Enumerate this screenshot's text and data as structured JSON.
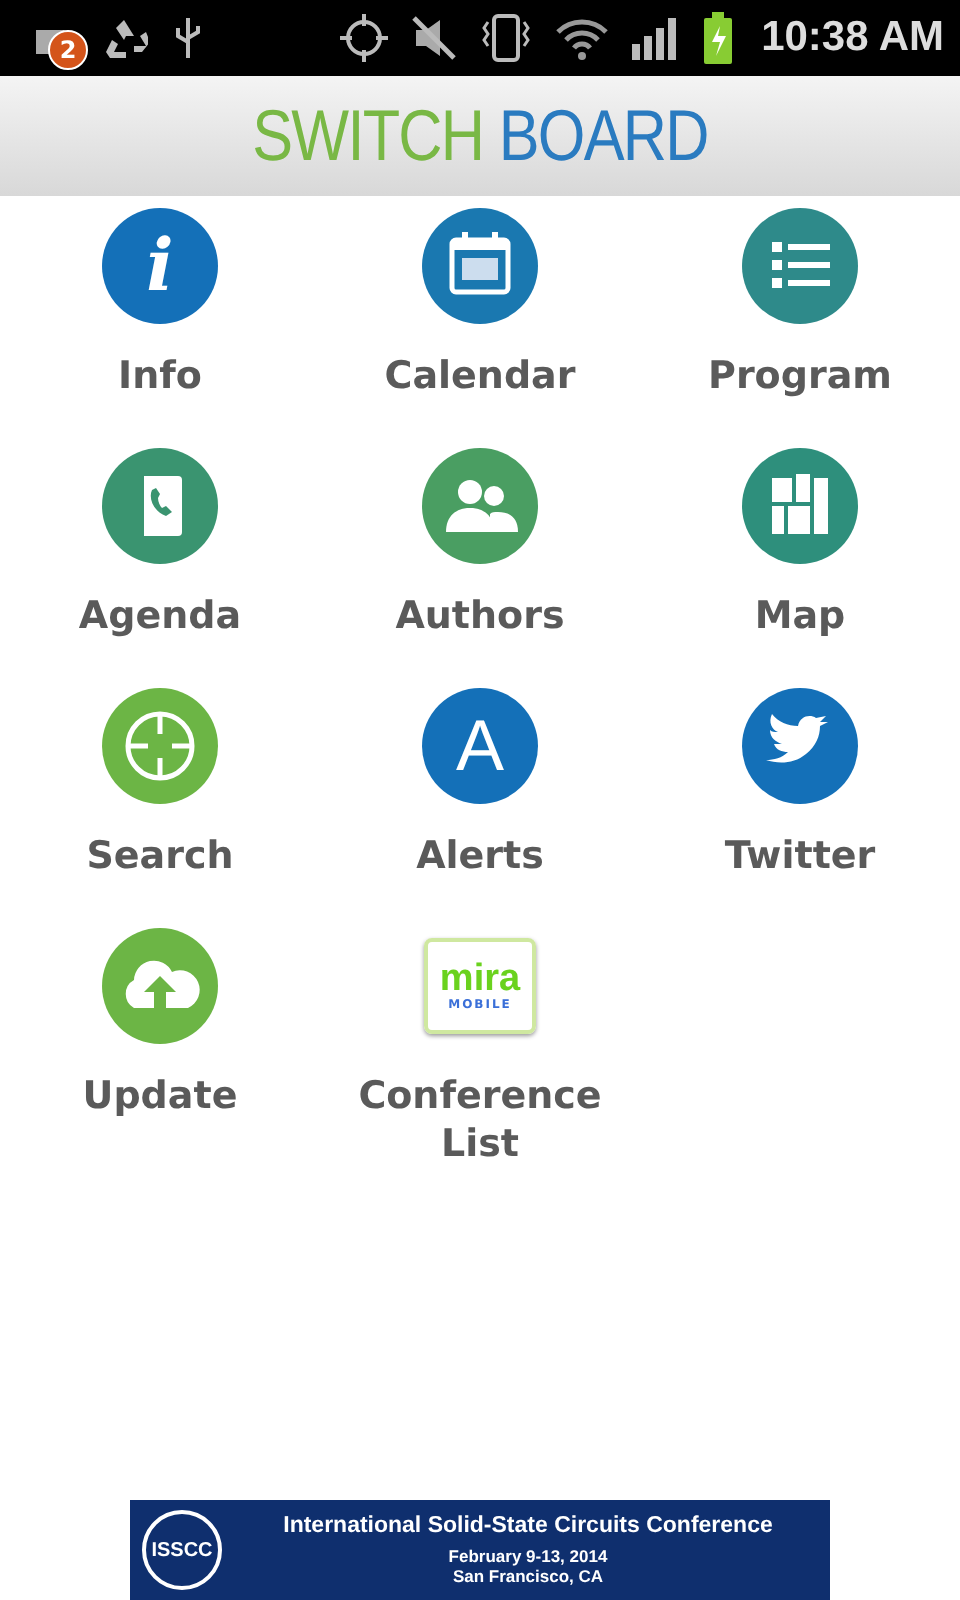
{
  "status_bar": {
    "notification_count": "2",
    "time": "10:38 AM"
  },
  "header": {
    "title_first": "SWITCH",
    "title_second": "BOARD"
  },
  "tiles": [
    {
      "label": "Info",
      "kind": "info",
      "glyph": "i",
      "color": "#1470b8"
    },
    {
      "label": "Calendar",
      "kind": "calendar",
      "color": "#1a78b0"
    },
    {
      "label": "Program",
      "kind": "list",
      "color": "#2e8a8a"
    },
    {
      "label": "Agenda",
      "kind": "contacts",
      "color": "#3a9470"
    },
    {
      "label": "Authors",
      "kind": "people",
      "color": "#4a9e62"
    },
    {
      "label": "Map",
      "kind": "map",
      "color": "#2e8f7c"
    },
    {
      "label": "Search",
      "kind": "target",
      "color": "#6cb545"
    },
    {
      "label": "Alerts",
      "kind": "letter",
      "glyph": "A",
      "color": "#1470b8"
    },
    {
      "label": "Twitter",
      "kind": "bird",
      "color": "#1470b8"
    },
    {
      "label": "Update",
      "kind": "upload",
      "color": "#6cb545"
    },
    {
      "label": "Conference List",
      "kind": "logo",
      "logo_main": "mira",
      "logo_sub": "MOBILE"
    }
  ],
  "banner": {
    "title": "International Solid-State Circuits Conference",
    "logo_text": "ISSCC",
    "dates": "February 9-13, 2014",
    "place": "San Francisco, CA"
  }
}
